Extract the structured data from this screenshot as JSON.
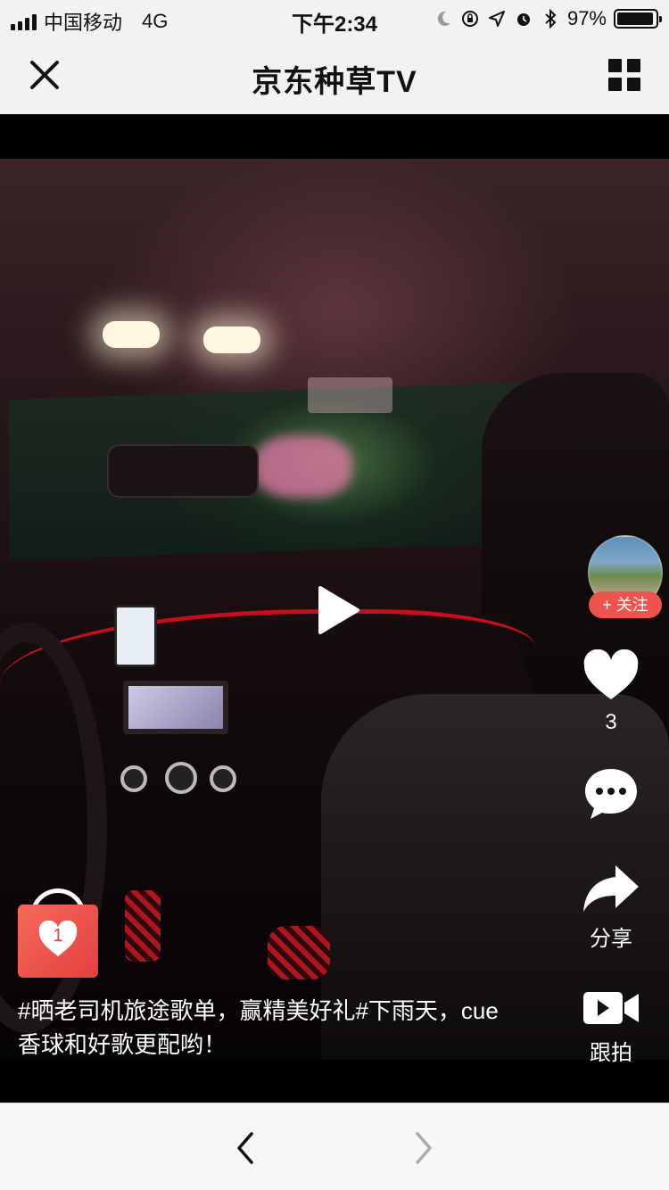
{
  "status_bar": {
    "carrier": "中国移动",
    "network": "4G",
    "time": "下午2:34",
    "battery_percent": "97%",
    "battery_level": 0.97
  },
  "nav": {
    "title": "京东种草TV"
  },
  "video": {
    "author": {
      "follow_label": "+ 关注"
    },
    "like_count": "3",
    "share_label": "分享",
    "shoot_label": "跟拍",
    "cart_count": "1",
    "caption": "#晒老司机旅途歌单，赢精美好礼#下雨天，cue香球和好歌更配哟！"
  },
  "icons": {
    "close": "close-icon",
    "grid": "grid-menu-icon",
    "play": "play-icon",
    "heart": "heart-icon",
    "comment": "comment-bubble-icon",
    "share": "share-arrow-icon",
    "camera": "video-camera-icon",
    "cart": "shopping-bag-icon",
    "back": "chevron-left-icon",
    "forward": "chevron-right-icon"
  },
  "colors": {
    "accent": "#f0534c",
    "cart": "#e34040",
    "nav_bg": "#f2f2f2"
  }
}
